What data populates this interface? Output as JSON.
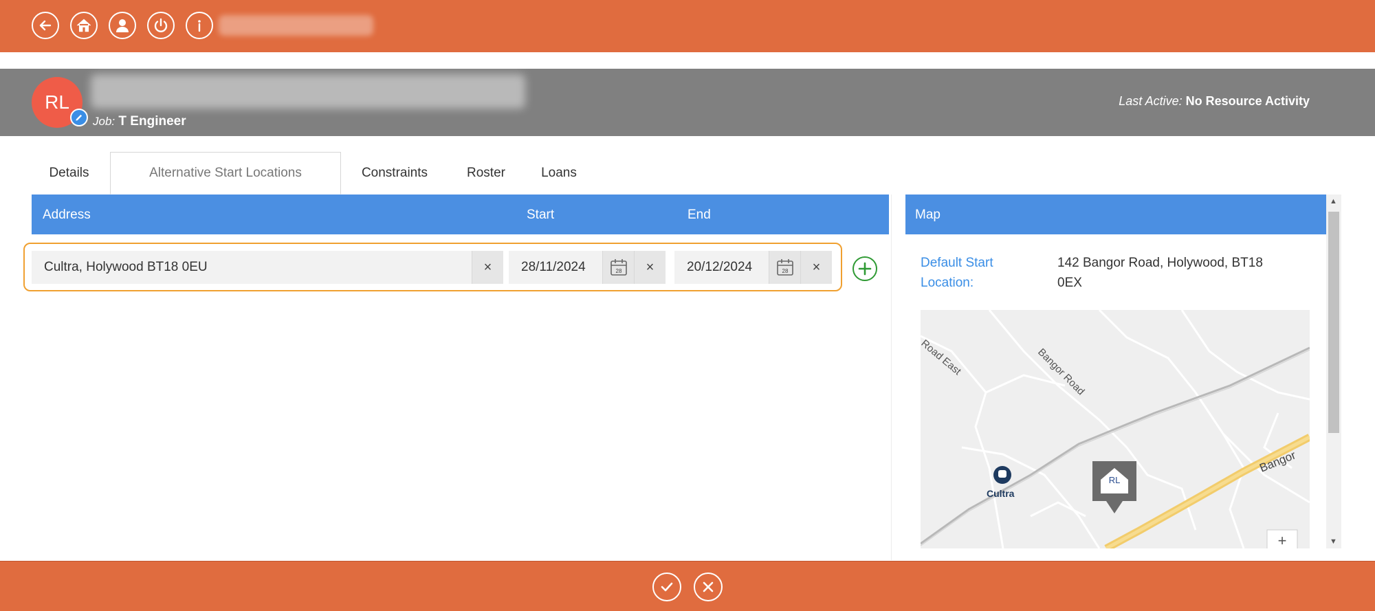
{
  "header": {
    "icons": [
      "back-arrow-icon",
      "home-icon",
      "user-icon",
      "power-icon",
      "info-icon"
    ]
  },
  "resource": {
    "initials": "RL",
    "job_label": "Job:",
    "job_value": "T Engineer",
    "last_active_label": "Last Active:",
    "last_active_value": "No Resource Activity"
  },
  "tabs": [
    {
      "label": "Details",
      "active": false
    },
    {
      "label": "Alternative Start Locations",
      "active": true
    },
    {
      "label": "Constraints",
      "active": false
    },
    {
      "label": "Roster",
      "active": false
    },
    {
      "label": "Loans",
      "active": false
    }
  ],
  "grid": {
    "columns": [
      "Address",
      "Start",
      "End"
    ],
    "rows": [
      {
        "address": "Cultra, Holywood BT18 0EU",
        "start": "28/11/2024",
        "end": "20/12/2024"
      }
    ],
    "calendar_icon_text": "28",
    "clear_glyph": "×"
  },
  "map_panel": {
    "title": "Map",
    "default_start_label": "Default Start Location:",
    "default_start_value": "142 Bangor Road, Holywood, BT18 0EX",
    "map": {
      "labels": [
        "Road East",
        "Bangor Road",
        "Bangor",
        "Cultra"
      ],
      "marker_text": "RL",
      "zoom_in_glyph": "+"
    }
  },
  "colors": {
    "accent_orange": "#e06c3f",
    "header_gray": "#808080",
    "grid_header_blue": "#4b8fe2",
    "avatar_red": "#ef5c48",
    "add_green": "#2f9a34",
    "row_outline": "#f0a030"
  },
  "footer": {
    "icons": [
      "confirm-check-icon",
      "cancel-x-icon"
    ]
  }
}
